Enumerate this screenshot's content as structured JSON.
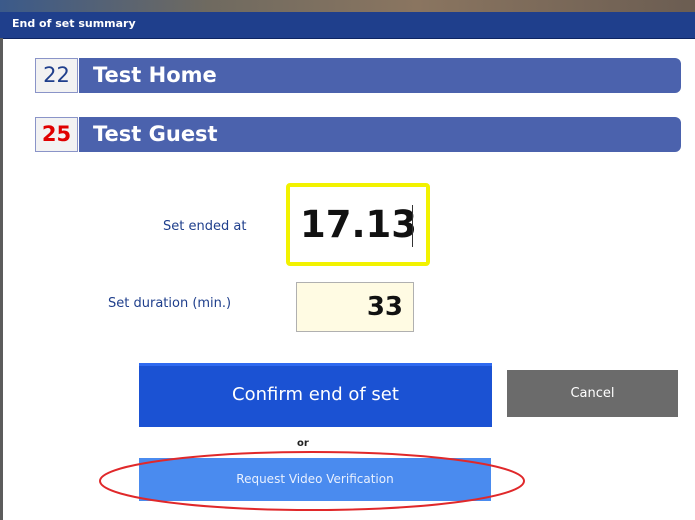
{
  "dialog": {
    "title": "End of set summary"
  },
  "teams": {
    "home": {
      "score": "22",
      "name": "Test Home"
    },
    "guest": {
      "score": "25",
      "name": "Test Guest"
    }
  },
  "set_ended": {
    "label": "Set ended at",
    "value": "17.13"
  },
  "set_duration": {
    "label": "Set duration (min.)",
    "value": "33"
  },
  "buttons": {
    "confirm": "Confirm end of set",
    "cancel": "Cancel",
    "or_text": "or",
    "video_verification": "Request Video Verification"
  },
  "colors": {
    "title_bar": "#1f3f8c",
    "team_bar": "#4b62ad",
    "guest_score": "#e00000",
    "highlight_yellow": "#f2f200",
    "confirm_button": "#1b52d3",
    "cancel_button": "#6b6b6b",
    "video_button": "#4a8bef",
    "annotation_ring": "#e0282a"
  }
}
